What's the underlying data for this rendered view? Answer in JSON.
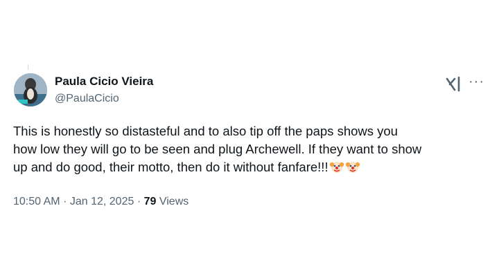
{
  "tweet": {
    "author": {
      "display_name": "Paula Cicio Vieira",
      "handle": "@PaulaCicio"
    },
    "text": "This is honestly so distasteful and to also tip off the paps shows you\nhow low they will go to be seen and plug Archewell.  If they want to show\nup and do good, their motto, then do it without fanfare!!!",
    "emojis": [
      "clown-face",
      "clown-face"
    ],
    "time": "10:50 AM",
    "separator": "·",
    "date": "Jan 12, 2025",
    "views_count": "79",
    "views_label": "Views",
    "icons": {
      "grok": "grok-icon",
      "more": "more-options-icon"
    },
    "more_glyph": "···"
  }
}
